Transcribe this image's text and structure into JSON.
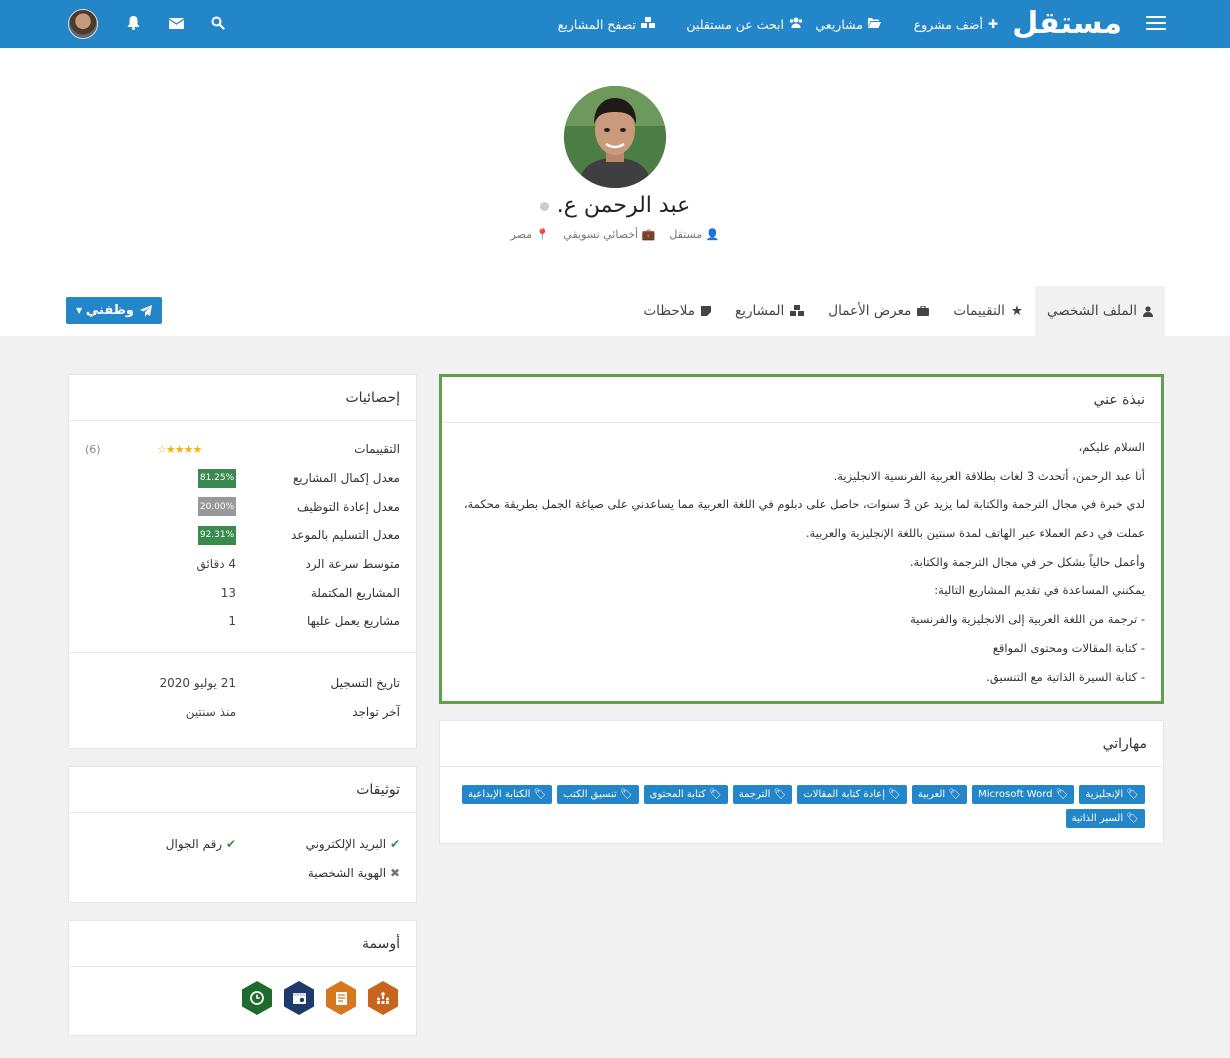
{
  "topbar": {
    "logo": "مستقل",
    "nav": [
      {
        "label": "أضف مشروع",
        "icon": "plus-icon"
      },
      {
        "label": "مشاريعي",
        "icon": "folder-open-icon"
      },
      {
        "label": "ابحث عن مستقلين",
        "icon": "users-icon"
      },
      {
        "label": "تصفح المشاريع",
        "icon": "cubes-icon"
      }
    ],
    "icons": [
      "search-icon",
      "envelope-icon",
      "bell-icon"
    ]
  },
  "profile": {
    "name": "عبد الرحمن ع.",
    "meta": [
      {
        "text": "مستقل",
        "icon": "user-icon"
      },
      {
        "text": "أخصائي تسويقي",
        "icon": "briefcase-icon"
      },
      {
        "text": "مصر",
        "icon": "map-marker-icon"
      }
    ]
  },
  "tabs": [
    {
      "label": "الملف الشخصي",
      "icon": "user-icon",
      "active": true
    },
    {
      "label": "التقييمات",
      "icon": "star-icon"
    },
    {
      "label": "معرض الأعمال",
      "icon": "briefcase-icon"
    },
    {
      "label": "المشاريع",
      "icon": "cubes-icon"
    },
    {
      "label": "ملاحظات",
      "icon": "sticky-note-icon"
    }
  ],
  "hire_button": "وظفني",
  "about": {
    "title": "نبذة عني",
    "lines": [
      "السلام عليكم،",
      "أنا عبد الرحمن، أتحدث 3 لغات بطلاقة العربية الفرنسية الانجليزية.",
      "لدي خبرة في مجال الترجمة والكتابة لما يزيد عن 3 سنوات، حاصل على دبلوم في اللغة العربية مما يساعدني على صياغة الجمل بطريقة محكمة،",
      "عملت في دعم العملاء عبر الهاتف لمدة سنتين باللغة الإنجليزية والعربية.",
      "وأعمل حالياً بشكل حر في مجال الترجمة والكتابة.",
      "يمكنني المساعدة في تقديم المشاريع التالية:",
      "- ترجمة من اللغة العربية إلى الانجليزية والفرنسية",
      "- كتابة المقالات ومحتوى المواقع",
      "- كتابة السيرة الذاتية مع التنسيق."
    ]
  },
  "skills": {
    "title": "مهاراتي",
    "items": [
      "الإنجليزية",
      "Microsoft Word",
      "العربية",
      "إعادة كتابة المقالات",
      "الترجمة",
      "كتابة المحتوى",
      "تنسيق الكتب",
      "الكتابة الإبداعية",
      "السير الذاتية"
    ]
  },
  "stats": {
    "title": "إحصائيات",
    "rating_label": "التقييمات",
    "rating_value": 4.5,
    "rating_count": "(6)",
    "rows": [
      {
        "label": "معدل إكمال المشاريع",
        "value": "81.25%",
        "color": "#3a8a4f"
      },
      {
        "label": "معدل إعادة التوظيف",
        "value": "20.00%",
        "color": "#999999"
      },
      {
        "label": "معدل التسليم بالموعد",
        "value": "92.31%",
        "color": "#3a8a4f"
      },
      {
        "label": "متوسط سرعة الرد",
        "value": "4 دقائق"
      },
      {
        "label": "المشاريع المكتملة",
        "value": "13"
      },
      {
        "label": "مشاريع يعمل عليها",
        "value": "1"
      }
    ],
    "dates": [
      {
        "label": "تاريخ التسجيل",
        "value": "21 يوليو 2020"
      },
      {
        "label": "آخر تواجد",
        "value": "منذ سنتين"
      }
    ]
  },
  "verifications": {
    "title": "توثيقات",
    "items": [
      {
        "label": "البريد الإلكتروني",
        "verified": true
      },
      {
        "label": "رقم الجوال",
        "verified": true
      },
      {
        "label": "الهوية الشخصية",
        "verified": false
      }
    ]
  },
  "awards": {
    "title": "أوسمة",
    "items": [
      {
        "icon": "team-icon",
        "color": "#c8641e"
      },
      {
        "icon": "document-icon",
        "color": "#d8781e"
      },
      {
        "icon": "calendar-icon",
        "color": "#1d3a6b"
      },
      {
        "icon": "clock-icon",
        "color": "#1e6b2d"
      }
    ]
  }
}
